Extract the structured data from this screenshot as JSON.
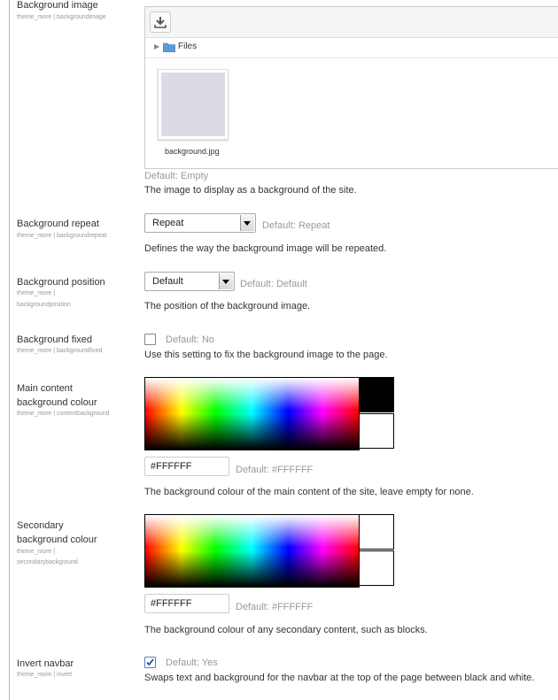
{
  "settings": {
    "bgimage": {
      "label": "Background image",
      "sub": "theme_more | backgroundimage",
      "files_label": "Files",
      "file_name": "background.jpg",
      "default": "Default: Empty",
      "desc": "The image to display as a background of the site."
    },
    "bgrepeat": {
      "label": "Background repeat",
      "sub": "theme_more | backgroundrepeat",
      "value": "Repeat",
      "default": "Default: Repeat",
      "desc": "Defines the way the background image will be repeated."
    },
    "bgposition": {
      "label": "Background position",
      "sub1": "theme_more |",
      "sub2": "backgroundposition",
      "value": "Default",
      "default": "Default: Default",
      "desc": "The position of the background image."
    },
    "bgfixed": {
      "label": "Background fixed",
      "sub": "theme_more | backgroundfixed",
      "checked": false,
      "default": "Default: No",
      "desc": "Use this setting to fix the background image to the page."
    },
    "contentbg": {
      "label1": "Main content",
      "label2": "background colour",
      "sub": "theme_more | contentbackground",
      "value": "#FFFFFF",
      "default": "Default: #FFFFFF",
      "desc": "The background colour of the main content of the site, leave empty for none.",
      "swatch_top": "#000000",
      "swatch_bottom": "#ffffff"
    },
    "secondarybg": {
      "label1": "Secondary",
      "label2": "background colour",
      "sub1": "theme_more |",
      "sub2": "secondarybackground",
      "value": "#FFFFFF",
      "default": "Default: #FFFFFF",
      "desc": "The background colour of any secondary content, such as blocks.",
      "swatch_top": "#ffffff",
      "swatch_bottom": "#ffffff"
    },
    "invertnavbar": {
      "label": "Invert navbar",
      "sub": "theme_more | invert",
      "checked": true,
      "default": "Default: Yes",
      "desc": "Swaps text and background for the navbar at the top of the page between black and white."
    }
  }
}
